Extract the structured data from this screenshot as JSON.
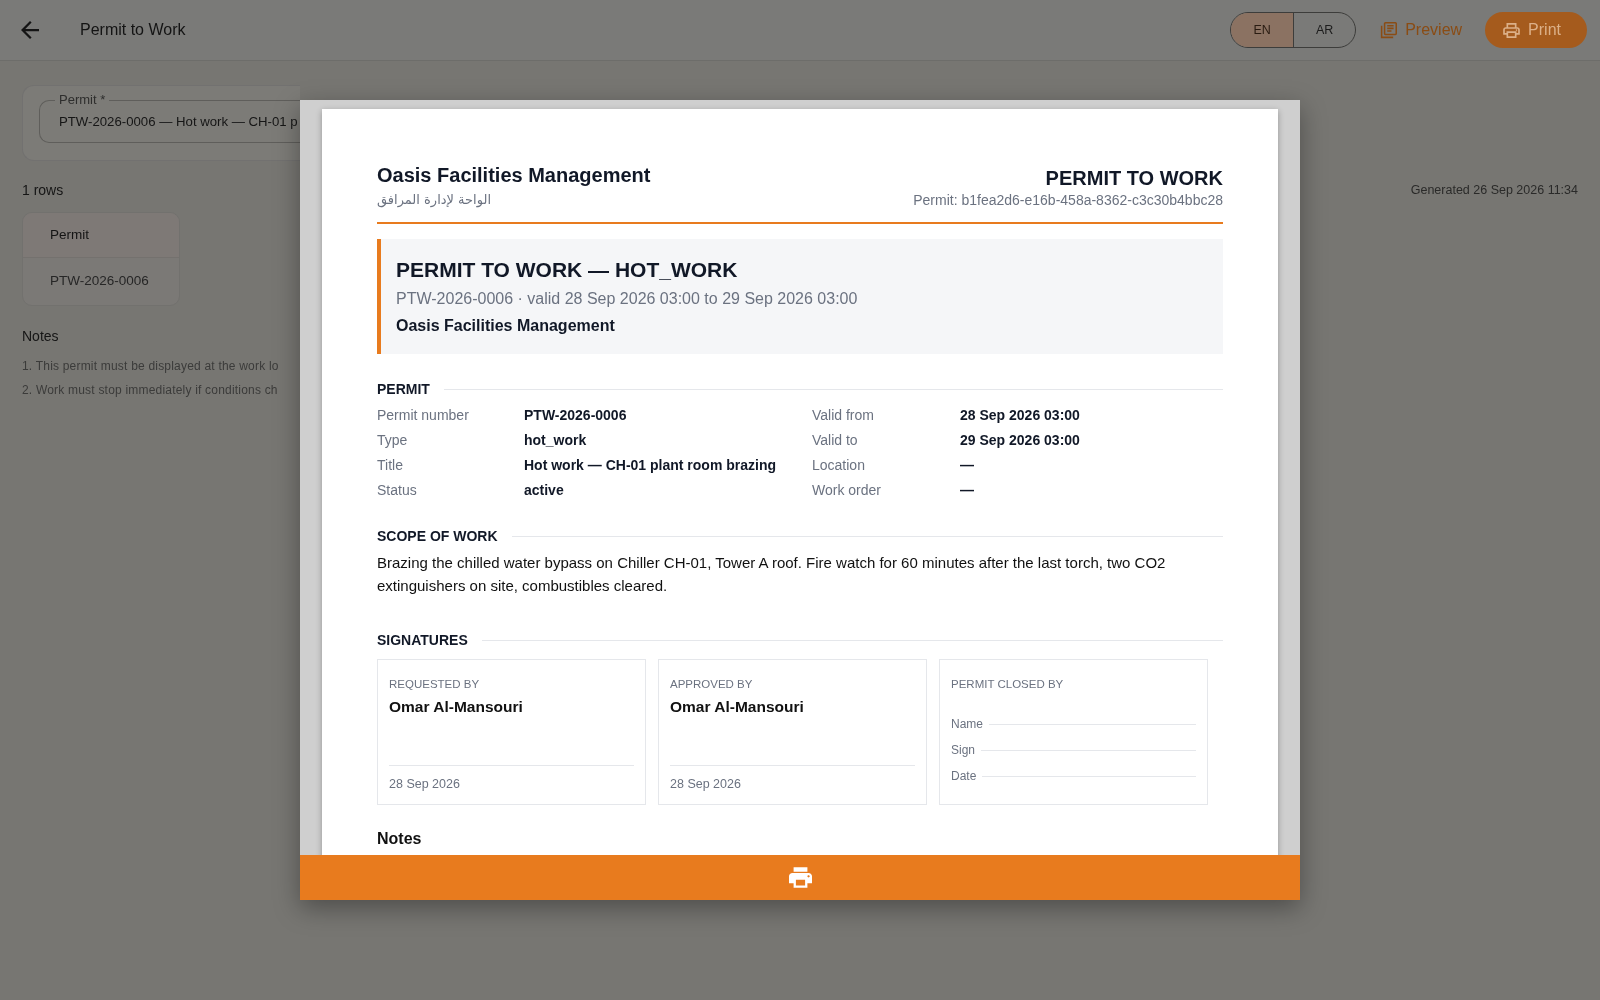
{
  "app_bar": {
    "title": "Permit to Work",
    "languages": [
      {
        "label": "EN",
        "selected": true
      },
      {
        "label": "AR",
        "selected": false
      }
    ],
    "actions": [
      {
        "kind": "text",
        "label": "Preview"
      },
      {
        "kind": "filled",
        "label": "Print"
      }
    ]
  },
  "filter_card": {
    "field": {
      "label": "Permit *",
      "value": "PTW-2026-0006 — Hot work — CH-01 p"
    }
  },
  "results": {
    "count": "1 rows",
    "generated": "Generated 26 Sep 2026 11:34",
    "table": {
      "columns": [
        "Permit"
      ],
      "rows": [
        [
          "PTW-2026-0006"
        ]
      ]
    }
  },
  "notes": {
    "title": "Notes",
    "items": [
      "1. This permit must be displayed at the work lo",
      "2. Work must stop immediately if conditions ch"
    ]
  },
  "preview_dialog": {
    "document": {
      "header": {
        "org_name": "Oasis Facilities Management",
        "org_name_ar": "الواحة لإدارة المرافق",
        "doc_title": "PERMIT TO WORK",
        "doc_ref": "Permit: b1fea2d6-e16b-458a-8362-c3c30b4bbc28"
      },
      "banner": {
        "title": "PERMIT TO WORK — HOT_WORK",
        "subtitle": "PTW-2026-0006 · valid 28 Sep 2026 03:00 to 29 Sep 2026 03:00",
        "org": "Oasis Facilities Management"
      },
      "sections": [
        {
          "kind": "fields",
          "title": "PERMIT",
          "columns": [
            [
              {
                "label": "Permit number",
                "value": "PTW-2026-0006"
              },
              {
                "label": "Type",
                "value": "hot_work"
              },
              {
                "label": "Title",
                "value": "Hot work — CH-01 plant room brazing"
              },
              {
                "label": "Status",
                "value": "active"
              }
            ],
            [
              {
                "label": "Valid from",
                "value": "28 Sep 2026 03:00"
              },
              {
                "label": "Valid to",
                "value": "29 Sep 2026 03:00"
              },
              {
                "label": "Location",
                "value": "—"
              },
              {
                "label": "Work order",
                "value": "—"
              }
            ]
          ]
        },
        {
          "kind": "text",
          "title": "SCOPE OF WORK",
          "text": "Brazing the chilled water bypass on Chiller CH-01, Tower A roof. Fire watch for 60 minutes after the last torch, two CO2 extinguishers on site, combustibles cleared."
        },
        {
          "kind": "signatures",
          "title": "SIGNATURES",
          "boxes": [
            {
              "kind": "signed",
              "role": "REQUESTED BY",
              "name": "Omar Al-Mansouri",
              "date": "28 Sep 2026"
            },
            {
              "kind": "signed",
              "role": "APPROVED BY",
              "name": "Omar Al-Mansouri",
              "date": "28 Sep 2026"
            },
            {
              "kind": "blank",
              "role": "PERMIT CLOSED BY",
              "lines": [
                "Name",
                "Sign",
                "Date"
              ]
            }
          ]
        },
        {
          "kind": "notes",
          "title": "Notes"
        }
      ]
    }
  }
}
